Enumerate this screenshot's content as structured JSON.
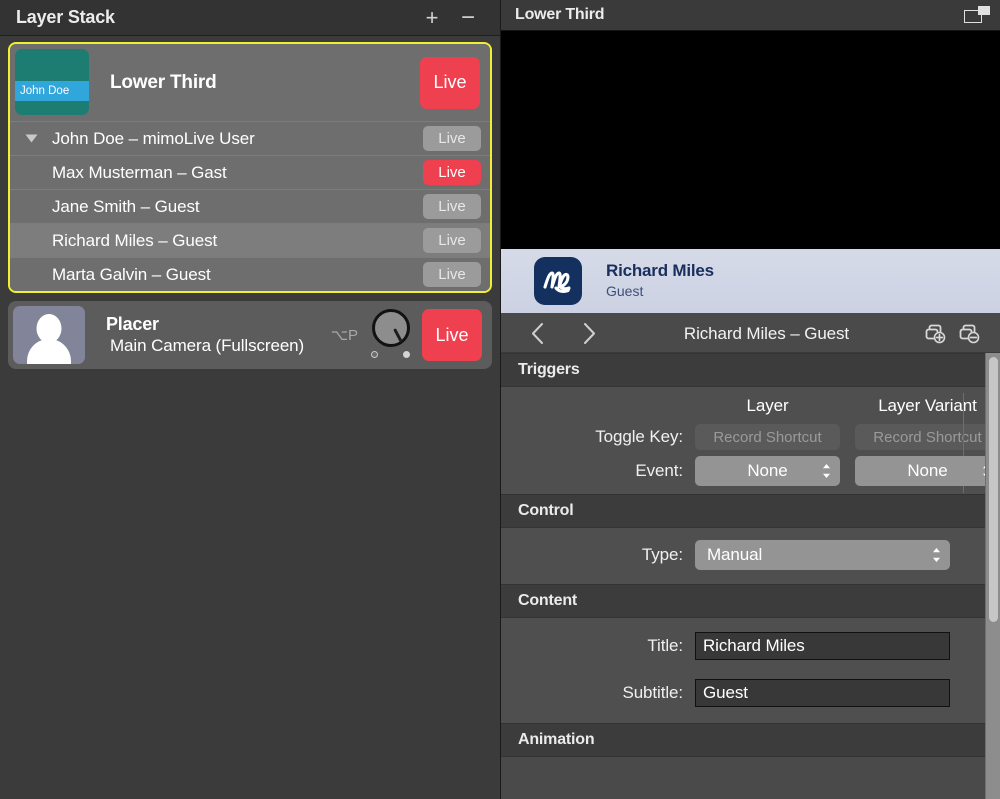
{
  "left_panel": {
    "header": {
      "title": "Layer Stack",
      "add_label": "+",
      "remove_label": "−"
    },
    "group": {
      "title": "Lower Third",
      "thumbnail_caption": "John Doe",
      "live_label": "Live",
      "live_state": "on",
      "variants": [
        {
          "label": "John Doe – mimoLive User",
          "live_label": "Live",
          "live_state": "off",
          "selected": false,
          "has_disclosure": true
        },
        {
          "label": "Max Musterman – Gast",
          "live_label": "Live",
          "live_state": "on",
          "selected": false,
          "has_disclosure": false
        },
        {
          "label": "Jane Smith – Guest",
          "live_label": "Live",
          "live_state": "off",
          "selected": false,
          "has_disclosure": false
        },
        {
          "label": "Richard Miles – Guest",
          "live_label": "Live",
          "live_state": "off",
          "selected": true,
          "has_disclosure": false
        },
        {
          "label": "Marta Galvin – Guest",
          "live_label": "Live",
          "live_state": "off",
          "selected": false,
          "has_disclosure": false
        }
      ]
    },
    "placer": {
      "title": "Placer",
      "subtitle": "Main Camera (Fullscreen)",
      "shortcut": "⌥P",
      "live_label": "Live",
      "live_state": "on"
    }
  },
  "right_panel": {
    "header": {
      "title": "Lower Third"
    },
    "preview": {
      "lower_third_title": "Richard Miles",
      "lower_third_subtitle": "Guest"
    },
    "nav": {
      "prev": "‹",
      "next": "›",
      "title": "Richard Miles – Guest"
    },
    "triggers": {
      "section_title": "Triggers",
      "column_layer": "Layer",
      "column_layer_variant": "Layer Variant",
      "toggle_key_label": "Toggle Key:",
      "toggle_key_layer_value": "Record Shortcut",
      "toggle_key_variant_value": "Record Shortcut",
      "event_label": "Event:",
      "event_layer_value": "None",
      "event_variant_value": "None"
    },
    "control": {
      "section_title": "Control",
      "type_label": "Type:",
      "type_value": "Manual"
    },
    "content": {
      "section_title": "Content",
      "title_label": "Title:",
      "title_value": "Richard Miles",
      "subtitle_label": "Subtitle:",
      "subtitle_value": "Guest"
    },
    "animation": {
      "section_title": "Animation"
    }
  },
  "colors": {
    "live_on": "#ef4050",
    "live_off": "#9b9b9b",
    "selection_outline": "#f2ee34",
    "thumbnail_bg": "#1d7d73",
    "thumbnail_band": "#30a6db",
    "logo_navy": "#13305e",
    "lower_third_bg": "#d6dae8"
  }
}
